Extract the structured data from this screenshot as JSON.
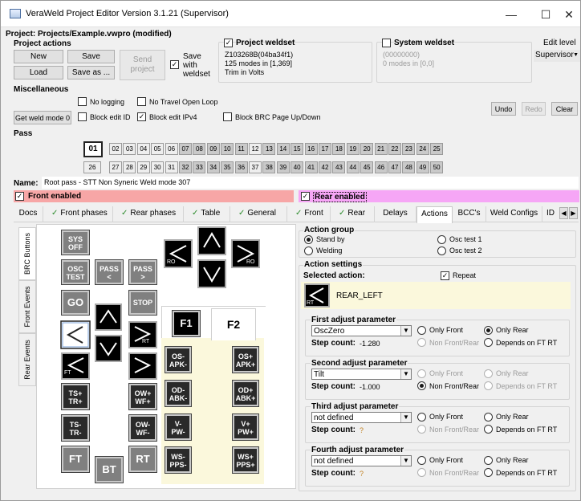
{
  "window": {
    "title": "VeraWeld Project Editor Version 3.1.21 (Supervisor)",
    "min": "—",
    "max": "☐",
    "close": "✕"
  },
  "project": {
    "label": "Project: Projects/Example.vwpro (modified)"
  },
  "project_actions": {
    "title": "Project actions",
    "new": "New",
    "save": "Save",
    "send": "Send project",
    "load": "Load",
    "save_as": "Save as ...",
    "save_with_weldset": "Save with weldset"
  },
  "project_weldset": {
    "title": "Project weldset",
    "line1": "Z103268B(04ba34f1)",
    "line2": "125 modes in [1,369]",
    "line3": "Trim in Volts"
  },
  "system_weldset": {
    "title": "System weldset",
    "line1": "(00000000)",
    "line2": "0 modes in [0,0]"
  },
  "edit_level": {
    "label": "Edit level",
    "value": "Supervisor"
  },
  "misc": {
    "title": "Miscellaneous",
    "get_weld_mode": "Get weld mode 0",
    "no_logging": "No logging",
    "no_travel": "No Travel Open Loop",
    "block_edit_id": "Block edit ID",
    "block_edit_ipv4": "Block edit IPv4",
    "block_brc": "Block BRC Page Up/Down",
    "undo": "Undo",
    "redo": "Redo",
    "clear": "Clear"
  },
  "pass": {
    "title": "Pass",
    "row1": [
      "01",
      "02",
      "03",
      "04",
      "05",
      "06",
      "07",
      "08",
      "09",
      "10",
      "11",
      "12",
      "13",
      "14",
      "15",
      "16",
      "17",
      "18",
      "19",
      "20",
      "21",
      "22",
      "23",
      "24",
      "25"
    ],
    "row2": [
      "26",
      "27",
      "28",
      "29",
      "30",
      "31",
      "32",
      "33",
      "34",
      "35",
      "36",
      "37",
      "38",
      "39",
      "40",
      "41",
      "42",
      "43",
      "44",
      "45",
      "46",
      "47",
      "48",
      "49",
      "50"
    ]
  },
  "name": {
    "label": "Name:",
    "value": "Root pass - STT Non Syneric Weld mode 307"
  },
  "front_enabled": "Front enabled",
  "rear_enabled": "Rear enabled",
  "tabs": [
    "Docs",
    "Front phases",
    "Rear phases",
    "Table",
    "General",
    "Front",
    "Rear",
    "Delays",
    "Actions",
    "BCC's",
    "Weld Configs",
    "ID"
  ],
  "vtabs": [
    "BRC Buttons",
    "Front Events",
    "Rear Events"
  ],
  "pad": {
    "sys_off": "SYS OFF",
    "osc_test": "OSC TEST",
    "pass_prev": "PASS <",
    "pass_next": "PASS >",
    "go": "GO",
    "stop": "STOP",
    "ts_tr_plus": "TS+ TR+",
    "ts_tr_minus": "TS- TR-",
    "ow_wf_plus": "OW+ WF+",
    "ow_wf_minus": "OW- WF-",
    "ft": "FT",
    "bt": "BT",
    "rt": "RT",
    "f1": "F1",
    "f2": "F2",
    "os_apk_minus": "OS- APK-",
    "os_apk_plus": "OS+ APK+",
    "od_abk_minus": "OD- ABK-",
    "od_abk_plus": "OD+ ABK+",
    "v_pw_minus": "V- PW-",
    "v_pw_plus": "V+ PW+",
    "ws_pps_minus": "WS- PPS-",
    "ws_pps_plus": "WS+ PPS+",
    "ro": "RO",
    "rt_sub": "RT",
    "ft_sub": "FT"
  },
  "action_group": {
    "title": "Action group",
    "stand_by": "Stand by",
    "welding": "Welding",
    "osc1": "Osc test 1",
    "osc2": "Osc test 2"
  },
  "action_settings": {
    "title": "Action settings",
    "selected": "Selected action:",
    "repeat": "Repeat",
    "action_name": "REAR_LEFT",
    "action_sub": "RT"
  },
  "params": [
    {
      "title": "First adjust parameter",
      "value": "OscZero",
      "step_label": "Step count:",
      "step": "-1.280",
      "only_front": "Only Front",
      "only_rear": "Only Rear",
      "non_front_rear": "Non Front/Rear",
      "depends": "Depends on FT RT"
    },
    {
      "title": "Second adjust parameter",
      "value": "Tilt",
      "step_label": "Step count:",
      "step": "-1.000",
      "only_front": "Only Front",
      "only_rear": "Only Rear",
      "non_front_rear": "Non Front/Rear",
      "depends": "Depends on FT RT"
    },
    {
      "title": "Third adjust parameter",
      "value": "not defined",
      "step_label": "Step count:",
      "step": "?",
      "only_front": "Only Front",
      "only_rear": "Only Rear",
      "non_front_rear": "Non Front/Rear",
      "depends": "Depends on FT RT"
    },
    {
      "title": "Fourth adjust parameter",
      "value": "not defined",
      "step_label": "Step count:",
      "step": "?",
      "only_front": "Only Front",
      "only_rear": "Only Rear",
      "non_front_rear": "Non Front/Rear",
      "depends": "Depends on FT RT"
    }
  ],
  "colors": {
    "front": "#f7a6a6",
    "rear": "#f6a6f6",
    "action_panel": "#fbf8dc"
  }
}
